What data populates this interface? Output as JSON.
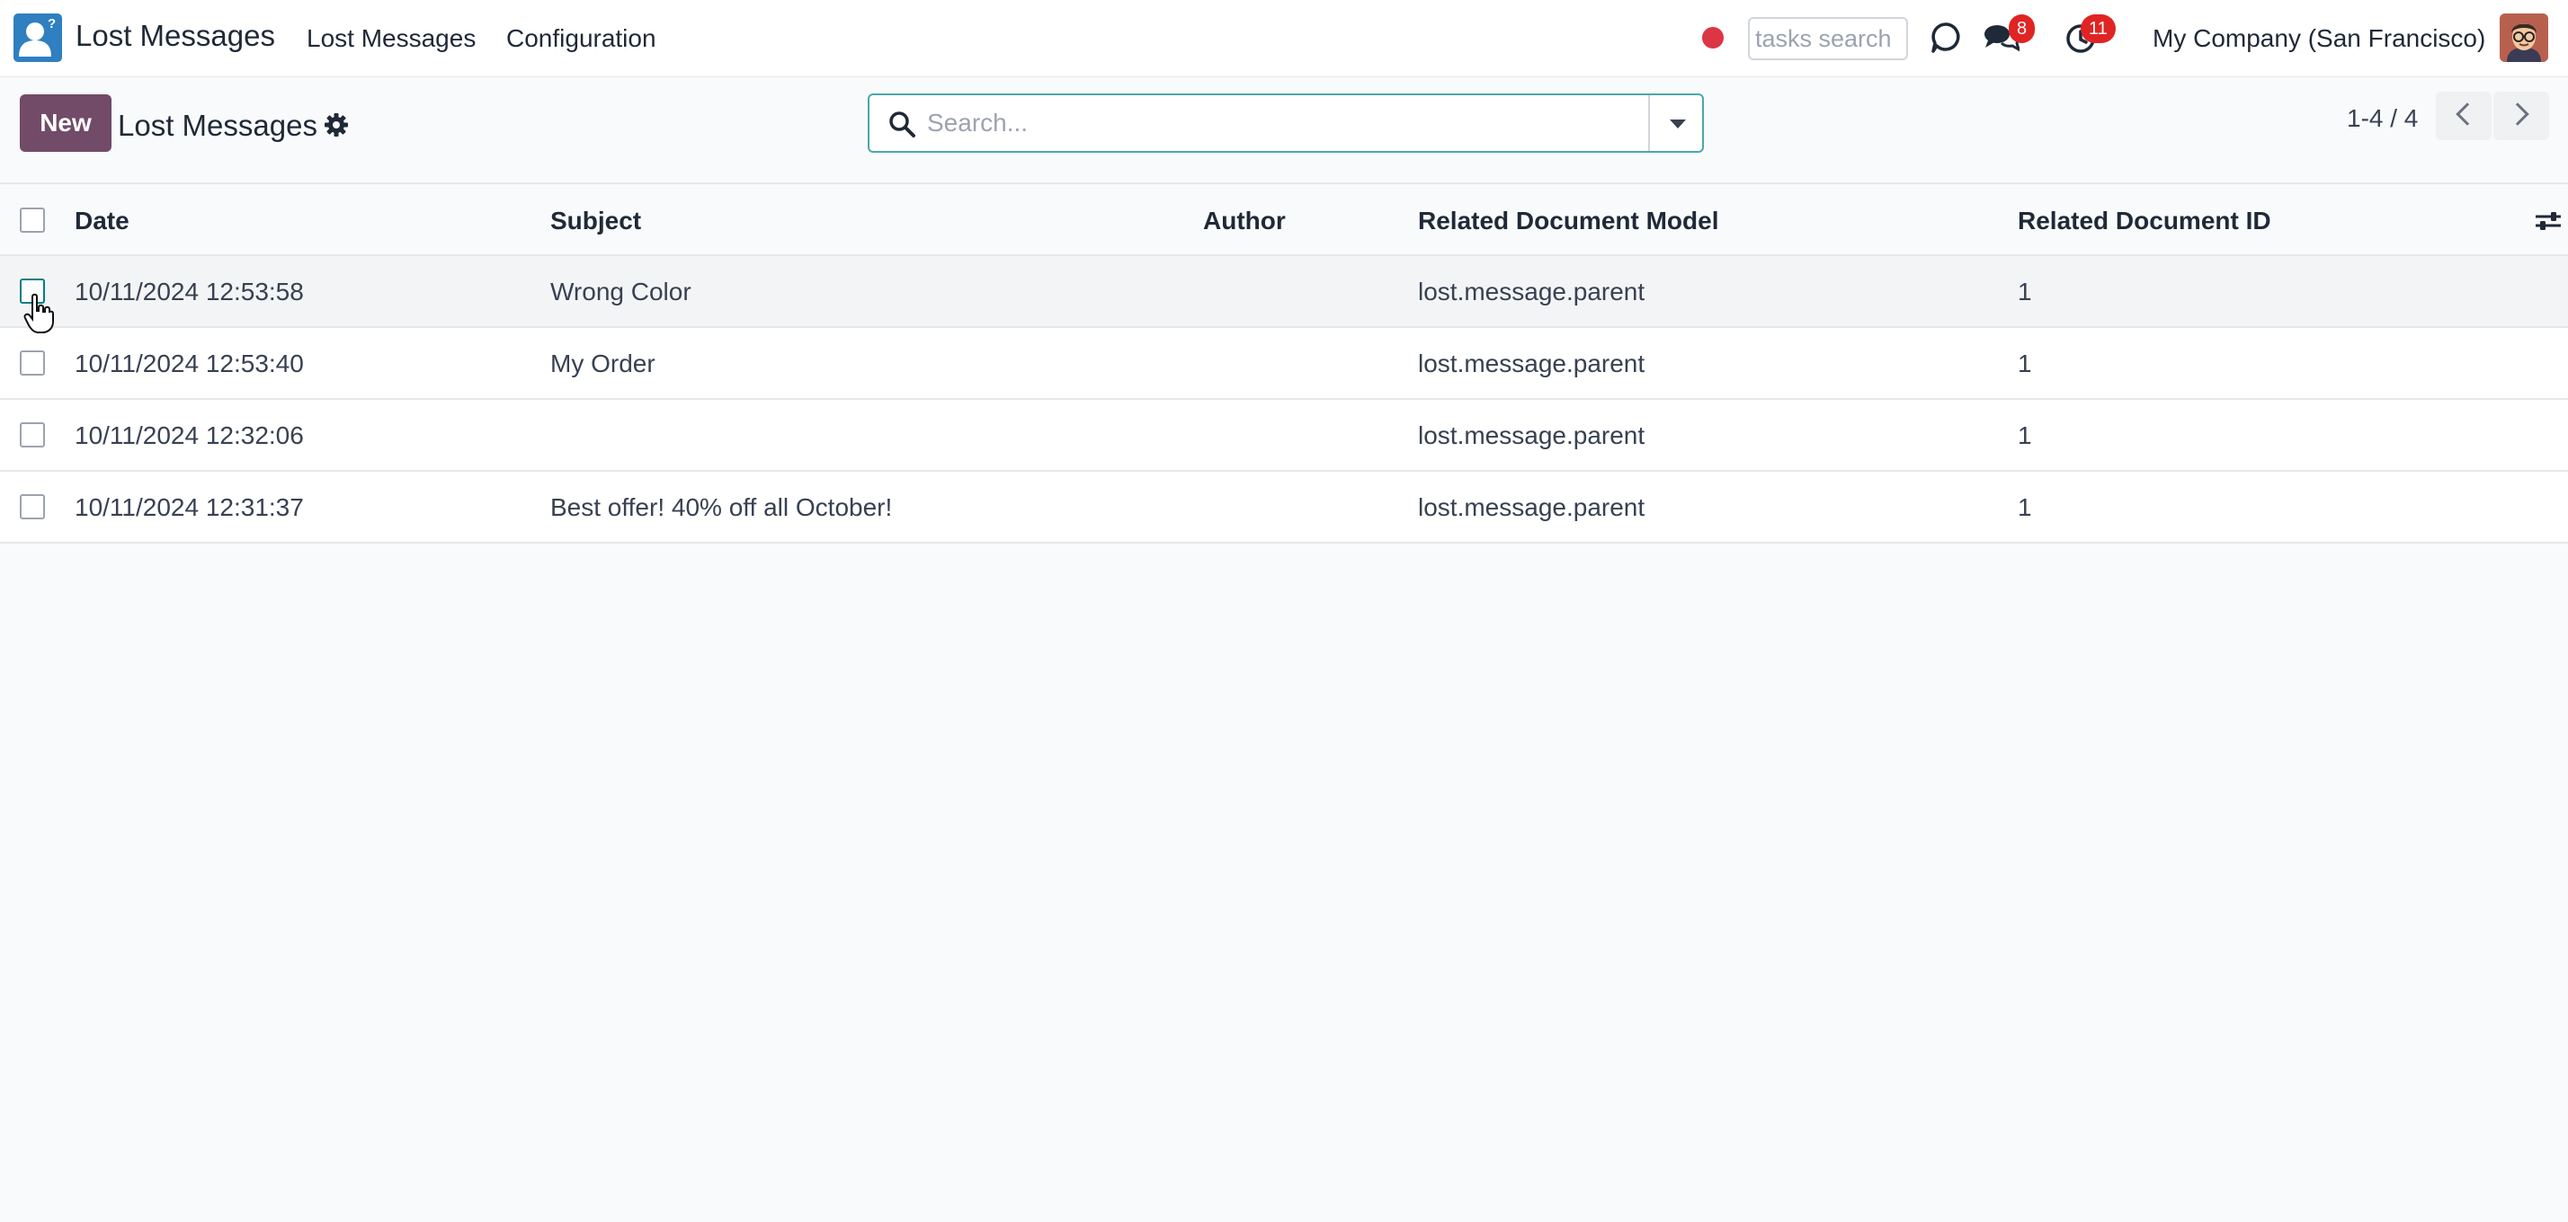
{
  "navbar": {
    "app_title": "Lost Messages",
    "menus": [
      "Lost Messages",
      "Configuration"
    ],
    "tasks_search_placeholder": "tasks search",
    "messages_badge": "8",
    "activities_badge": "11",
    "company": "My Company (San Francisco)"
  },
  "control_panel": {
    "new_label": "New",
    "title": "Lost Messages",
    "search_placeholder": "Search...",
    "pager": "1-4 / 4"
  },
  "table": {
    "columns": [
      "Date",
      "Subject",
      "Author",
      "Related Document Model",
      "Related Document ID"
    ],
    "rows": [
      {
        "date": "10/11/2024 12:53:58",
        "subject": "Wrong Color",
        "author": "",
        "model": "lost.message.parent",
        "res_id": "1"
      },
      {
        "date": "10/11/2024 12:53:40",
        "subject": "My Order",
        "author": "",
        "model": "lost.message.parent",
        "res_id": "1"
      },
      {
        "date": "10/11/2024 12:32:06",
        "subject": "",
        "author": "",
        "model": "lost.message.parent",
        "res_id": "1"
      },
      {
        "date": "10/11/2024 12:31:37",
        "subject": "Best offer! 40% off all October!",
        "author": "",
        "model": "lost.message.parent",
        "res_id": "1"
      }
    ]
  },
  "colors": {
    "brand": "#714b67",
    "badge": "#e02424",
    "search_border": "#4aa8a8"
  },
  "icons": [
    "app-icon",
    "record-dot-icon",
    "chat-icon",
    "messages-icon",
    "clock-icon",
    "gear-icon",
    "search-icon",
    "caret-down-icon",
    "chevron-left-icon",
    "chevron-right-icon",
    "column-options-icon"
  ]
}
